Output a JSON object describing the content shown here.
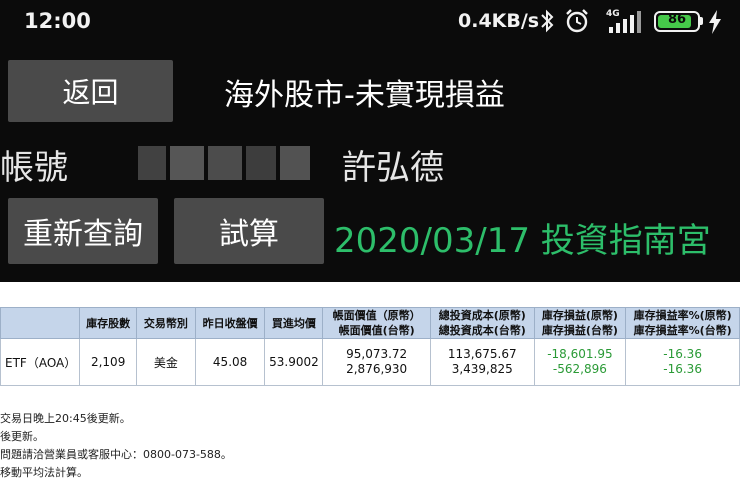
{
  "status_bar": {
    "time": "12:00",
    "network_speed": "0.4KB/s",
    "signal_label": "4G",
    "battery": "86",
    "battery_level": 0.86,
    "battery_color": "#46c94a"
  },
  "header": {
    "back_label": "返回",
    "title": "海外股市-未實現損益"
  },
  "account": {
    "label": "帳號",
    "holder_name": "許弘德"
  },
  "actions": {
    "requery_label": "重新查詢",
    "calc_label": "試算"
  },
  "date_guide": "2020/03/17 投資指南宮",
  "colors": {
    "date_guide": "#2dbe6a",
    "negative_value": "#2a9a36",
    "table_header_bg": "#c5d5ea"
  },
  "table": {
    "headers": [
      "",
      "庫存股數",
      "交易幣別",
      "昨日收盤價",
      "買進均價",
      "帳面價值（原幣）",
      "帳面價值(台幣)",
      "總投資成本(原幣)",
      "總投資成本(台幣)",
      "庫存損益(原幣)",
      "庫存損益(台幣)",
      "庫存損益率%(原幣)",
      "庫存損益率%(台幣)"
    ],
    "rows": [
      {
        "name": "ETF（AOA）",
        "shares": "2,109",
        "currency": "美金",
        "prev_close": "45.08",
        "avg_buy_price": "53.9002",
        "book_value_orig": "95,073.72",
        "book_value_twd": "2,876,930",
        "total_cost_orig": "113,675.67",
        "total_cost_twd": "3,439,825",
        "pnl_orig": "-18,601.95",
        "pnl_twd": "-562,896",
        "pnl_rate_orig": "-16.36",
        "pnl_rate_twd": "-16.36"
      }
    ]
  },
  "notes": [
    "交易日晚上20:45後更新。",
    "後更新。",
    "問題請洽營業員或客服中心：0800-073-588。",
    "移動平均法計算。"
  ]
}
